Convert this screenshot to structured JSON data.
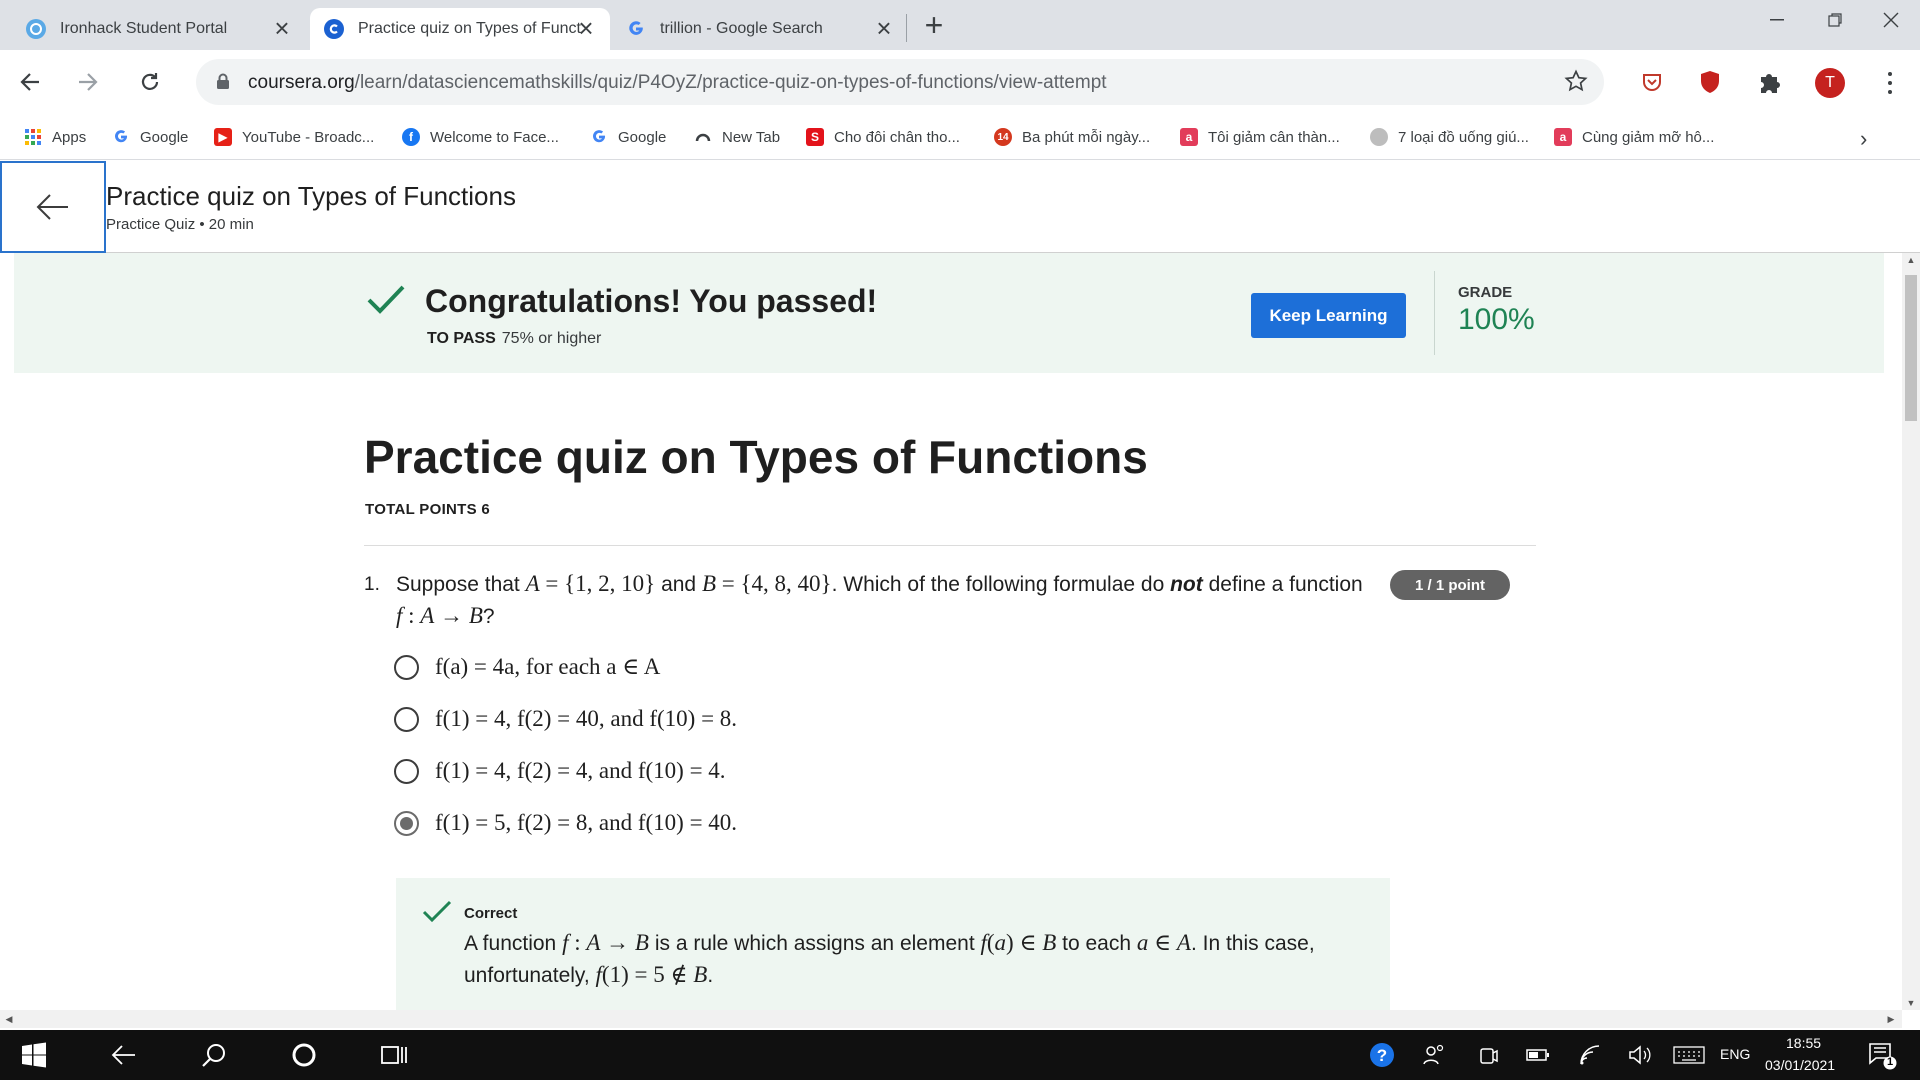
{
  "browser": {
    "tabs": [
      {
        "title": "Ironhack Student Portal",
        "active": false
      },
      {
        "title": "Practice quiz on Types of Funct",
        "active": true
      },
      {
        "title": "trillion - Google Search",
        "active": false
      }
    ],
    "url_domain": "coursera.org",
    "url_path": "/learn/datasciencemathskills/quiz/P4OyZ/practice-quiz-on-types-of-functions/view-attempt",
    "profile_initial": "T",
    "bookmarks": [
      {
        "label": "Apps",
        "icon": "apps-grid-icon"
      },
      {
        "label": "Google",
        "icon": "google-icon"
      },
      {
        "label": "YouTube - Broadc...",
        "icon": "youtube-icon"
      },
      {
        "label": "Welcome to Face...",
        "icon": "facebook-icon"
      },
      {
        "label": "Google",
        "icon": "google-icon"
      },
      {
        "label": "New Tab",
        "icon": "new-tab-icon"
      },
      {
        "label": "Cho đôi chân tho...",
        "icon": "s-icon"
      },
      {
        "label": "Ba phút mỗi ngày...",
        "icon": "14-icon"
      },
      {
        "label": "Tôi giảm cân thàn...",
        "icon": "a-icon"
      },
      {
        "label": "7 loại đồ uống giú...",
        "icon": "globe-icon"
      },
      {
        "label": "Cùng giảm mỡ hô...",
        "icon": "a-icon"
      }
    ]
  },
  "header": {
    "title": "Practice quiz on Types of Functions",
    "subtitle": "Practice Quiz • 20 min"
  },
  "banner": {
    "message": "Congratulations! You passed!",
    "to_pass_label": "TO PASS",
    "to_pass_value": "75% or higher",
    "button": "Keep Learning",
    "grade_label": "GRADE",
    "grade_value": "100%"
  },
  "quiz": {
    "title": "Practice quiz on Types of Functions",
    "total_points": "TOTAL POINTS 6",
    "question": {
      "number": "1.",
      "points": "1 / 1 point",
      "selected_option": 3,
      "options": [
        "f(a) = 4a, for each a ∈ A",
        "f(1) = 4, f(2) = 40, and f(10) = 8.",
        "f(1) = 4, f(2) = 4, and f(10) = 4.",
        "f(1) = 5, f(2) = 8, and f(10) = 40."
      ]
    },
    "feedback": {
      "label": "Correct"
    }
  },
  "taskbar": {
    "language": "ENG",
    "time": "18:55",
    "date": "03/01/2021",
    "notifications": "1"
  },
  "colors": {
    "accent": "#1d6fd8",
    "success": "#1f8354",
    "banner_bg": "#eef6f1"
  }
}
